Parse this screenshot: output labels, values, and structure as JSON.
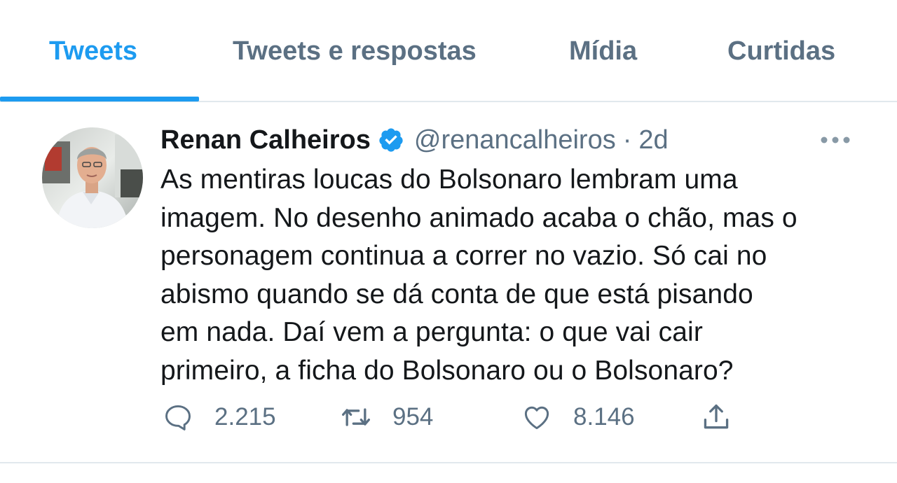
{
  "tabs": [
    {
      "label": "Tweets",
      "active": true
    },
    {
      "label": "Tweets e respostas",
      "active": false
    },
    {
      "label": "Mídia",
      "active": false
    },
    {
      "label": "Curtidas",
      "active": false
    }
  ],
  "tweet": {
    "author_name": "Renan Calheiros",
    "verified": true,
    "handle": "@renancalheiros",
    "separator": "·",
    "time": "2d",
    "lines": [
      "As mentiras loucas do Bolsonaro lembram uma",
      "imagem. No desenho animado acaba o chão, mas o",
      "personagem continua a correr no vazio. Só cai no",
      "abismo quando se dá conta de que está pisando",
      "em nada. Daí vem a pergunta: o que vai cair",
      "primeiro, a ficha do Bolsonaro ou o Bolsonaro?"
    ],
    "replies": "2.215",
    "retweets": "954",
    "likes": "8.146"
  },
  "icons": {
    "reply": "reply-icon",
    "retweet": "retweet-icon",
    "like": "heart-icon",
    "share": "share-icon",
    "more": "more-icon",
    "verified": "verified-badge-icon"
  },
  "colors": {
    "accent": "#1d9bf0",
    "secondary_text": "#5b7083",
    "primary_text": "#14171a",
    "divider": "#e1e8ed"
  }
}
